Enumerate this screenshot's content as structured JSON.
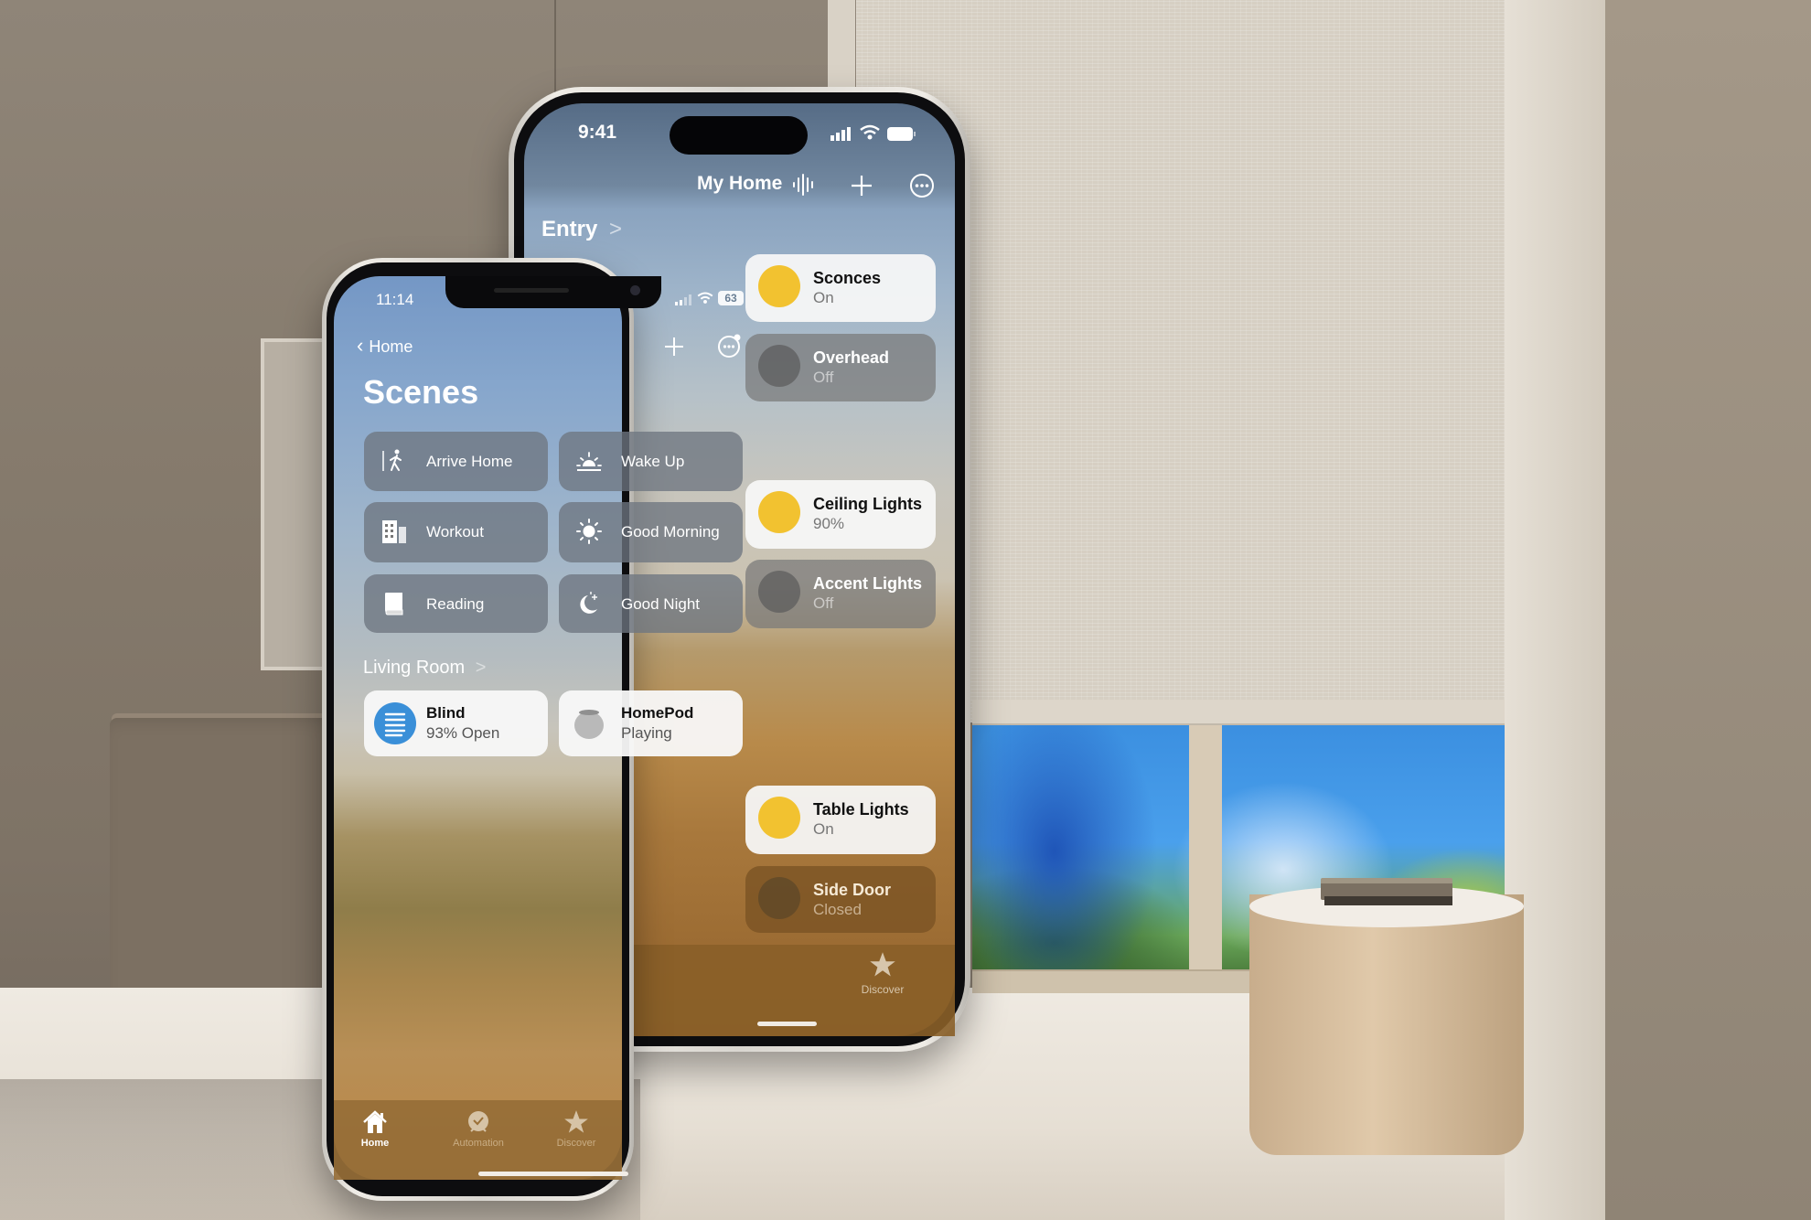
{
  "scene_background": {
    "description": "Living room with roller blind partially raised over a window showing mountains, wooden stool with books"
  },
  "back_phone": {
    "status_bar": {
      "time": "9:41",
      "icons": [
        "cellular-signal-icon",
        "wifi-icon",
        "battery-icon"
      ]
    },
    "nav": {
      "title": "My Home",
      "icons": [
        "waveform-icon",
        "plus-icon",
        "more-icon"
      ]
    },
    "section": {
      "label": "Entry",
      "chevron": ">"
    },
    "accessories": [
      {
        "name": "Sconces",
        "state": "On",
        "on": true
      },
      {
        "name": "Overhead",
        "state": "Off",
        "on": false
      },
      {
        "name": "Ceiling Lights",
        "state": "90%",
        "on": true
      },
      {
        "name": "Accent Lights",
        "state": "Off",
        "on": false
      },
      {
        "name": "Table Lights",
        "state": "On",
        "on": true
      },
      {
        "name": "Side Door",
        "state": "Closed",
        "on": false
      }
    ],
    "tab_bar": {
      "visible_tabs": [
        {
          "label": "Discover",
          "icon": "star-icon"
        }
      ]
    }
  },
  "front_phone": {
    "status_bar": {
      "time": "11:14",
      "battery": "63",
      "icons": [
        "cellular-signal-icon",
        "wifi-icon",
        "battery-icon"
      ]
    },
    "nav": {
      "back_label": "Home",
      "icons": [
        "plus-icon",
        "more-icon"
      ]
    },
    "title": "Scenes",
    "scenes": [
      {
        "label": "Arrive Home",
        "icon": "walking-person-icon"
      },
      {
        "label": "Wake Up",
        "icon": "sunrise-icon"
      },
      {
        "label": "Workout",
        "icon": "building-icon"
      },
      {
        "label": "Good Morning",
        "icon": "sun-icon"
      },
      {
        "label": "Reading",
        "icon": "book-icon"
      },
      {
        "label": "Good Night",
        "icon": "moon-stars-icon"
      }
    ],
    "section": {
      "label": "Living Room",
      "chevron": ">"
    },
    "accessories": [
      {
        "name": "Blind",
        "state": "93% Open",
        "icon": "blind-icon",
        "icon_color": "#3a8fd8"
      },
      {
        "name": "HomePod",
        "state": "Playing",
        "icon": "homepod-icon",
        "icon_color": "#b9b9b9"
      }
    ],
    "tab_bar": {
      "tabs": [
        {
          "label": "Home",
          "icon": "house-icon",
          "selected": true
        },
        {
          "label": "Automation",
          "icon": "clock-check-icon",
          "selected": false
        },
        {
          "label": "Discover",
          "icon": "star-icon",
          "selected": false
        }
      ]
    }
  },
  "colors": {
    "light_on_icon": "#f2c230",
    "tile_on_bg": "#f6f6f6",
    "tile_off_bg": "#787878",
    "blind_icon": "#3a8fd8"
  }
}
